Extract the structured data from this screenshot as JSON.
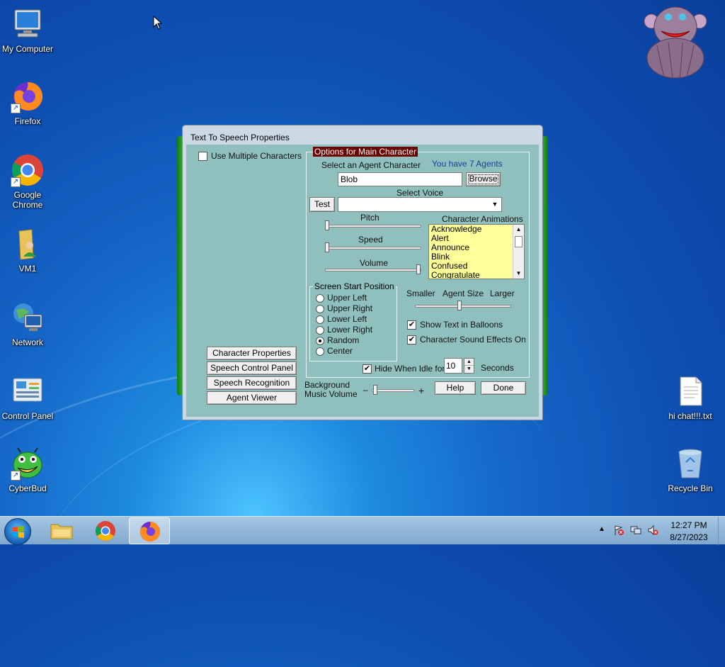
{
  "desktop": {
    "icons": [
      {
        "label": "My Computer",
        "icon": "computer-icon"
      },
      {
        "label": "Firefox",
        "icon": "firefox-icon"
      },
      {
        "label": "Google Chrome",
        "icon": "chrome-icon"
      },
      {
        "label": "VM1",
        "icon": "user-folder-icon"
      },
      {
        "label": "Network",
        "icon": "network-icon"
      },
      {
        "label": "Control Panel",
        "icon": "control-panel-icon"
      },
      {
        "label": "CyberBud",
        "icon": "cyberbud-icon"
      },
      {
        "label": "hi chat!!!.txt",
        "icon": "text-file-icon"
      },
      {
        "label": "Recycle Bin",
        "icon": "recycle-bin-icon"
      }
    ]
  },
  "window": {
    "title": "Text To Speech Properties",
    "use_multiple_label": "Use Multiple Characters",
    "use_multiple_checked": false,
    "options_title": "Options for Main Character",
    "select_agent_label": "Select an Agent Character",
    "agents_count_text": "You have 7 Agents",
    "agent_value": "Blob",
    "browse_label": "Browse",
    "select_voice_label": "Select Voice",
    "test_label": "Test",
    "voice_value": "",
    "pitch_label": "Pitch",
    "speed_label": "Speed",
    "volume_label": "Volume",
    "pitch_level": 0.0,
    "speed_level": 0.0,
    "volume_level": 1.0,
    "animations_label": "Character Animations",
    "animations": [
      "Acknowledge",
      "Alert",
      "Announce",
      "Blink",
      "Confused",
      "Congratulate"
    ],
    "screen_position_title": "Screen Start Position",
    "positions": [
      "Upper Left",
      "Upper Right",
      "Lower Left",
      "Lower Right",
      "Random",
      "Center"
    ],
    "selected_position": "Random",
    "smaller_label": "Smaller",
    "agent_size_label": "Agent Size",
    "larger_label": "Larger",
    "show_text_label": "Show Text in Balloons",
    "show_text_checked": true,
    "sound_effects_label": "Character Sound Effects On",
    "sound_effects_checked": true,
    "hide_idle_label": "Hide When Idle for",
    "hide_idle_checked": true,
    "idle_seconds": "10",
    "seconds_label": "Seconds",
    "bg_music_label_1": "Background",
    "bg_music_label_2": "Music Volume",
    "minus": "–",
    "plus": "+",
    "help_label": "Help",
    "done_label": "Done",
    "side_buttons": [
      "Character Properties",
      "Speech Control Panel",
      "Speech Recognition",
      "Agent Viewer"
    ]
  },
  "taskbar": {
    "time": "12:27 PM",
    "date": "8/27/2023",
    "pinned": [
      "explorer-icon",
      "chrome-icon",
      "firefox-icon"
    ]
  }
}
